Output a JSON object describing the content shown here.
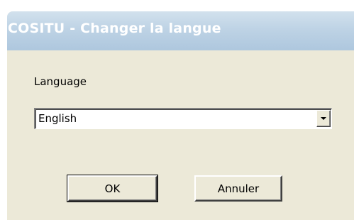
{
  "window": {
    "title": "COSITU - Changer la langue"
  },
  "form": {
    "language_label": "Language",
    "language_selected": "English"
  },
  "buttons": {
    "ok_label": "OK",
    "cancel_label": "Annuler"
  },
  "icons": {
    "dropdown": "chevron-down-icon"
  },
  "colors": {
    "dialog_background": "#ece9d8",
    "titlebar": "#bed3e5",
    "title_text": "#ffffff"
  }
}
